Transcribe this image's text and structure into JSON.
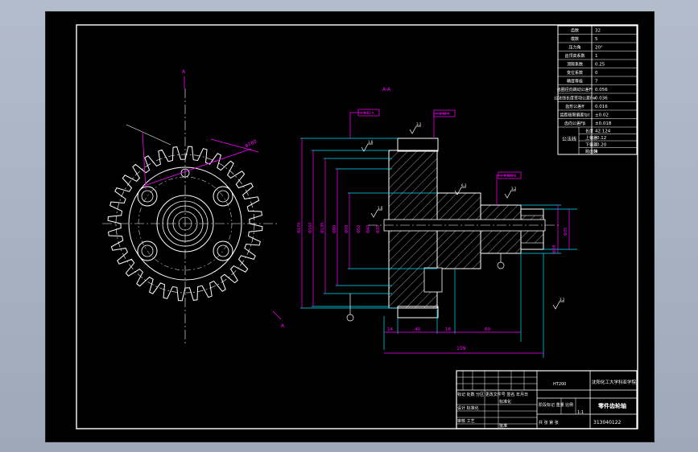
{
  "params": {
    "rows": [
      {
        "label": "齿数",
        "value": "32"
      },
      {
        "label": "模数",
        "value": "5"
      },
      {
        "label": "压力角",
        "value": "20°"
      },
      {
        "label": "齿顶高系数",
        "value": "1"
      },
      {
        "label": "顶隙系数",
        "value": "0.25"
      },
      {
        "label": "变位系数",
        "value": "0"
      },
      {
        "label": "精度等级",
        "value": "7"
      },
      {
        "label": "齿圈径向跳动公差Fr",
        "value": "0.056"
      },
      {
        "label": "公法线长度变动公差Fw",
        "value": "0.036"
      },
      {
        "label": "齿形公差ff",
        "value": "0.016"
      },
      {
        "label": "齿距极限偏差fpt",
        "value": "±0.02"
      },
      {
        "label": "齿向公差Fβ",
        "value": "±0.018"
      }
    ],
    "group_label": "公法线",
    "group_rows": [
      {
        "label": "长度",
        "value": "42.124"
      },
      {
        "label": "上偏差",
        "value": "-0.12"
      },
      {
        "label": "下偏差",
        "value": "-0.20"
      },
      {
        "label": "跨齿数",
        "value": "4"
      }
    ]
  },
  "titleblock": {
    "material": "HT200",
    "school": "沈阳化工大学科亚学院",
    "part_name": "零件齿轮轴",
    "drawing_no": "313040122",
    "row_header": "标记 处数 分区 更改文件号 签名 年月日",
    "designer_label": "设计 标准化",
    "checker_label": "审核 工艺",
    "approve_label": "批准",
    "stage_label": "阶段标记 重量 比例",
    "scale": "1:1",
    "sheet_label": "共 张 第 张",
    "std_label": "标准化"
  },
  "view": {
    "section_mark": "A",
    "section_label": "A-A",
    "pitch_label": "φ160",
    "radial_dims": [
      "Φ170",
      "Φ160",
      "Φ135",
      "Φ80",
      "Φ70",
      "Φ50",
      "Φ40",
      "Φ35"
    ],
    "shaft_dims": [
      "Φ35",
      "Φ28"
    ],
    "length_dims": [
      "14",
      "40",
      "18",
      "60"
    ],
    "total_len": "159",
    "roughness": [
      "1.6",
      "3.2",
      "6.3",
      "3.2",
      "1.6",
      "3.2"
    ],
    "tolerance_frames": [
      "⊥ 0.02 A",
      "↗ 0.03 A",
      "⊥ 0.025 B"
    ]
  },
  "colors": {
    "sheet": "#000000",
    "line": "#ffffff",
    "dim": "#ff00ff",
    "center": "#00e5ff",
    "red": "#ff3030",
    "yellow": "#ffff00"
  }
}
